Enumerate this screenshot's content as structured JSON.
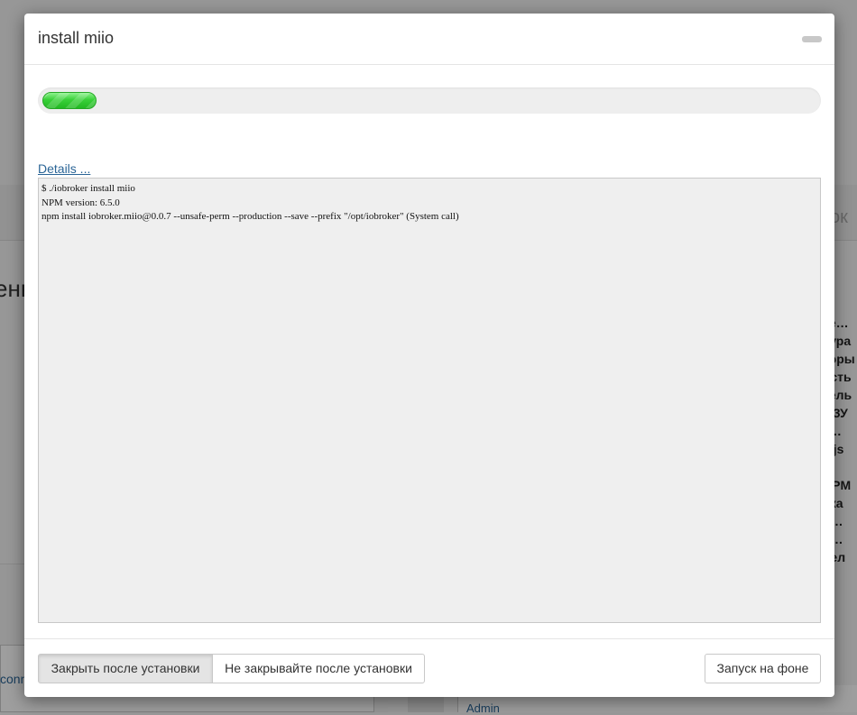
{
  "background": {
    "left_fragment": "ень",
    "right_fragment": "ок",
    "right_list": [
      "те…",
      "тура",
      "торы",
      "ость",
      "тель",
      "ОЗУ",
      "т…",
      "e.js",
      "",
      "NPM",
      "ска",
      "н…",
      "р…",
      "вел"
    ],
    "conn_text": "conn",
    "admin_link": "Admin"
  },
  "dialog": {
    "title": "install miio",
    "progress": {
      "percent": 7
    },
    "details_link": "Details ...",
    "console_lines": [
      "$ ./iobroker install miio",
      "NPM version: 6.5.0",
      "npm install iobroker.miio@0.0.7 --unsafe-perm --production --save --prefix \"/opt/iobroker\" (System call)"
    ],
    "buttons": {
      "close_after": "Закрыть после установки",
      "dont_close": "Не закрывайте после установки",
      "background": "Запуск на фоне"
    }
  },
  "colors": {
    "progress_green": "#38d038",
    "link_blue": "#2a6496",
    "console_bg": "#efefef"
  }
}
